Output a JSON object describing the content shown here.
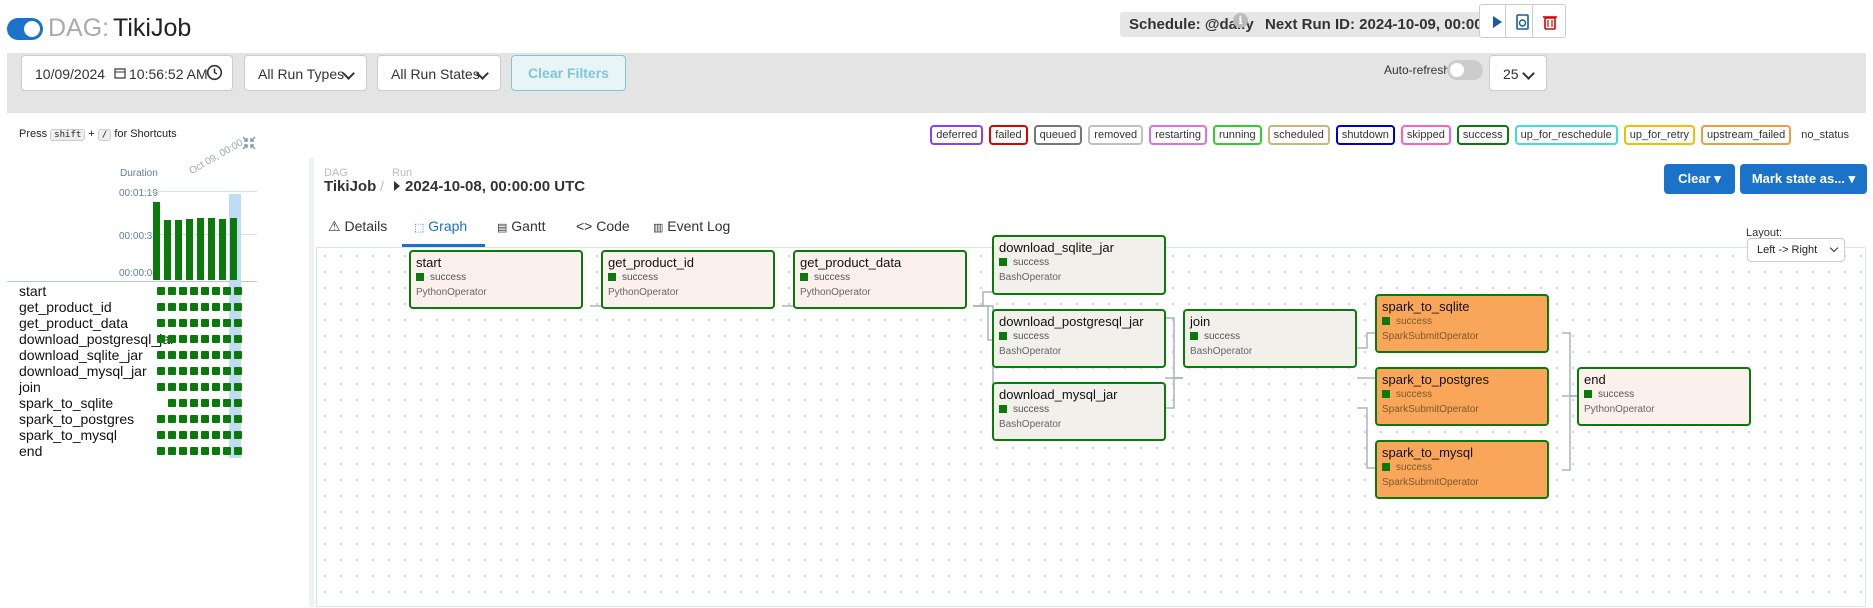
{
  "header": {
    "title_prefix": "DAG:",
    "dag_name": "TikiJob",
    "schedule": "Schedule: @daily",
    "next_run": "Next Run ID: 2024-10-09, 00:00:00 UTC",
    "info": "i"
  },
  "filters": {
    "date": "10/09/2024",
    "time": "10:56:52 AM",
    "run_types": "All Run Types",
    "run_states": "All Run States",
    "clear_filters": "Clear Filters",
    "auto_refresh": "Auto-refresh",
    "page_size": "25"
  },
  "shortcuts": {
    "press": "Press",
    "key1": "shift",
    "plus": "+",
    "key2": "/",
    "rest": "for Shortcuts"
  },
  "legend": [
    {
      "label": "deferred",
      "color": "#8a3ffc"
    },
    {
      "label": "failed",
      "color": "#e00000"
    },
    {
      "label": "queued",
      "color": "#777777"
    },
    {
      "label": "removed",
      "color": "#c0c0c0"
    },
    {
      "label": "restarting",
      "color": "#e070e0"
    },
    {
      "label": "running",
      "color": "#32cd32"
    },
    {
      "label": "scheduled",
      "color": "#c8b878"
    },
    {
      "label": "shutdown",
      "color": "#0000cc"
    },
    {
      "label": "skipped",
      "color": "#ff60c0"
    },
    {
      "label": "success",
      "color": "#0a7a0a"
    },
    {
      "label": "up_for_reschedule",
      "color": "#40e0d0"
    },
    {
      "label": "up_for_retry",
      "color": "#f0c000"
    },
    {
      "label": "upstream_failed",
      "color": "#e8a040"
    },
    {
      "label": "no_status",
      "color": ""
    }
  ],
  "grid": {
    "duration_label": "Duration",
    "ticks": [
      "00:01:19",
      "00:00:39",
      "00:00:00"
    ],
    "date_label": "Oct 09, 00:00",
    "tasks": [
      "start",
      "get_product_id",
      "get_product_data",
      "download_postgresql_jar",
      "download_sqlite_jar",
      "download_mysql_jar",
      "join",
      "spark_to_sqlite",
      "spark_to_postgres",
      "spark_to_mysql",
      "end"
    ]
  },
  "run": {
    "dag_kicker": "DAG",
    "run_kicker": "Run",
    "dag": "TikiJob",
    "sep": "/",
    "run_id": "2024-10-08, 00:00:00 UTC"
  },
  "tabs": [
    "Details",
    "Graph",
    "Gantt",
    "Code",
    "Event Log"
  ],
  "actions": {
    "clear": "Clear",
    "mark": "Mark state as..."
  },
  "layout": {
    "label": "Layout:",
    "value": "Left -> Right"
  },
  "nodes": {
    "start": {
      "name": "start",
      "state": "success",
      "op": "PythonOperator"
    },
    "get_product_id": {
      "name": "get_product_id",
      "state": "success",
      "op": "PythonOperator"
    },
    "get_product_data": {
      "name": "get_product_data",
      "state": "success",
      "op": "PythonOperator"
    },
    "download_sqlite_jar": {
      "name": "download_sqlite_jar",
      "state": "success",
      "op": "BashOperator"
    },
    "download_postgresql_jar": {
      "name": "download_postgresql_jar",
      "state": "success",
      "op": "BashOperator"
    },
    "download_mysql_jar": {
      "name": "download_mysql_jar",
      "state": "success",
      "op": "BashOperator"
    },
    "join": {
      "name": "join",
      "state": "success",
      "op": "BashOperator"
    },
    "spark_to_sqlite": {
      "name": "spark_to_sqlite",
      "state": "success",
      "op": "SparkSubmitOperator"
    },
    "spark_to_postgres": {
      "name": "spark_to_postgres",
      "state": "success",
      "op": "SparkSubmitOperator"
    },
    "spark_to_mysql": {
      "name": "spark_to_mysql",
      "state": "success",
      "op": "SparkSubmitOperator"
    },
    "end": {
      "name": "end",
      "state": "success",
      "op": "PythonOperator"
    }
  }
}
